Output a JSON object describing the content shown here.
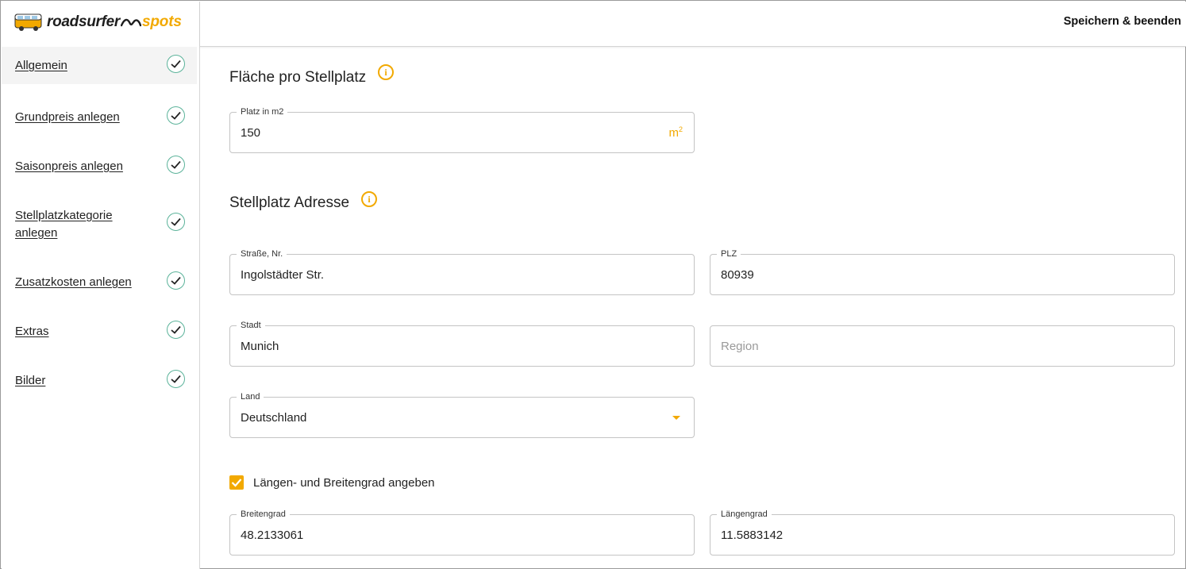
{
  "brand": {
    "name_part1": "roadsurfer",
    "name_part2": "spots",
    "accent_color": "#f2a900",
    "check_color": "#5bb39a"
  },
  "topbar": {
    "save_exit_label": "Speichern & beenden"
  },
  "sidebar": {
    "items": [
      {
        "label": "Allgemein",
        "completed": true,
        "active": true
      },
      {
        "label": "Grundpreis anlegen",
        "completed": true
      },
      {
        "label": "Saisonpreis anlegen",
        "completed": true
      },
      {
        "label": "Stellplatzkategorie anlegen",
        "completed": true
      },
      {
        "label": "Zusatzkosten anlegen",
        "completed": true
      },
      {
        "label": "Extras",
        "completed": true
      },
      {
        "label": "Bilder",
        "completed": true
      }
    ]
  },
  "area_section": {
    "title": "Fläche pro Stellplatz",
    "info_icon": "info-icon",
    "area_field": {
      "label": "Platz in m2",
      "value": "150",
      "unit": "m",
      "unit_sup": "2"
    }
  },
  "address_section": {
    "title": "Stellplatz Adresse",
    "info_icon": "info-icon",
    "street": {
      "label": "Straße, Nr.",
      "value": "Ingolstädter Str."
    },
    "zip": {
      "label": "PLZ",
      "value": "80939"
    },
    "city": {
      "label": "Stadt",
      "value": "Munich"
    },
    "region": {
      "placeholder": "Region",
      "value": ""
    },
    "country": {
      "label": "Land",
      "value": "Deutschland"
    },
    "coords_checkbox": {
      "label": "Längen- und Breitengrad angeben",
      "checked": true
    },
    "latitude": {
      "label": "Breitengrad",
      "value": "48.2133061"
    },
    "longitude": {
      "label": "Längengrad",
      "value": "11.5883142"
    }
  }
}
